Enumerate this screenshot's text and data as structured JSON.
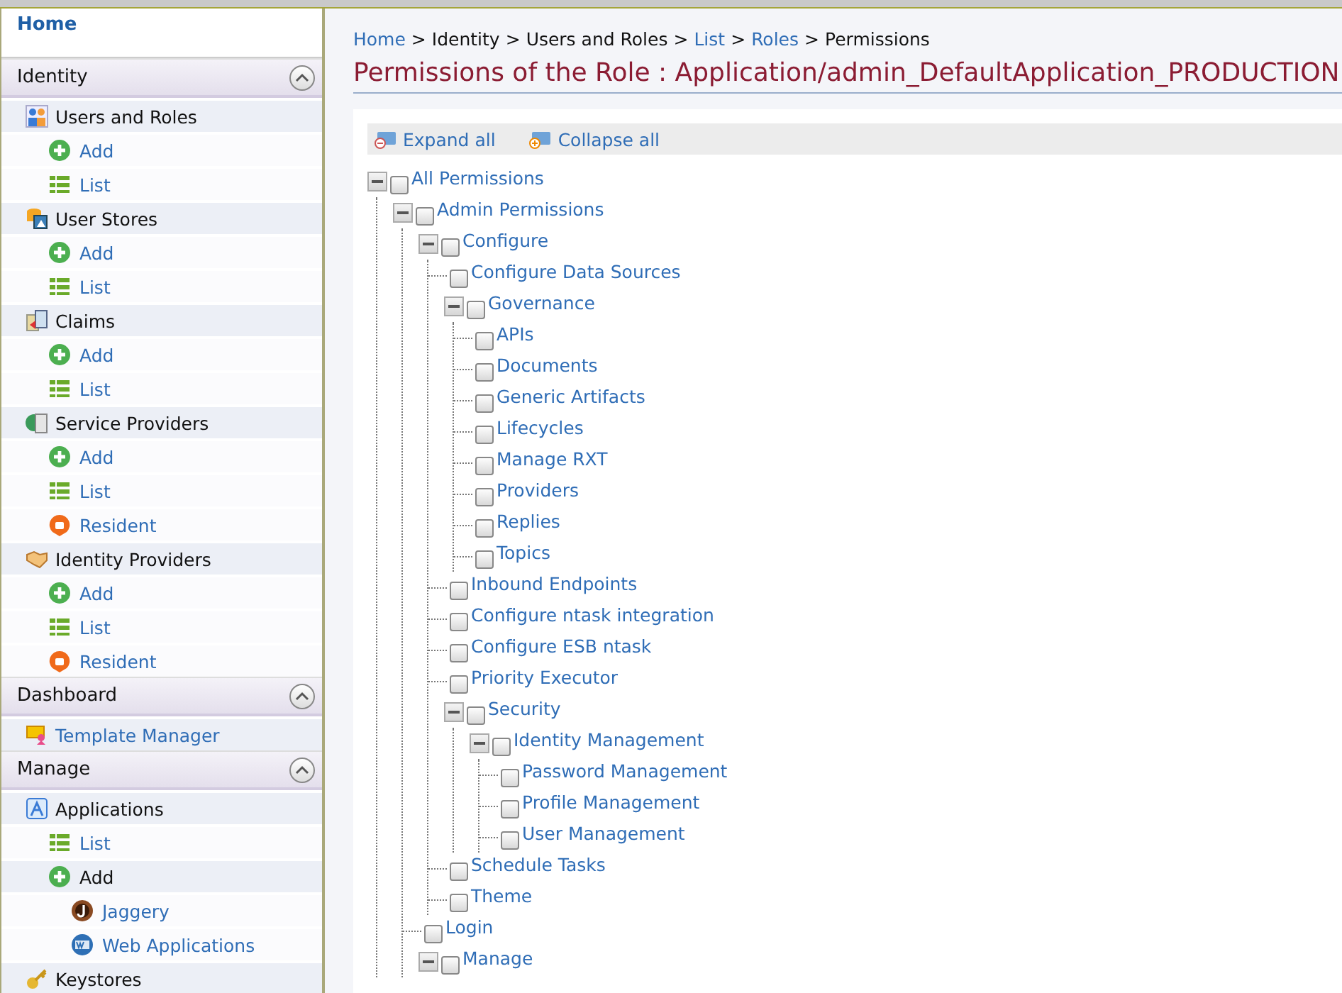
{
  "sidebar": {
    "home": "Home",
    "sections": [
      {
        "title": "Identity",
        "expanded": true,
        "items": [
          {
            "label": "Users and Roles",
            "kind": "users",
            "children": [
              {
                "label": "Add",
                "kind": "add",
                "selected": false
              },
              {
                "label": "List",
                "kind": "list",
                "selected": false
              }
            ]
          },
          {
            "label": "User Stores",
            "kind": "stores",
            "children": [
              {
                "label": "Add",
                "kind": "add",
                "selected": false
              },
              {
                "label": "List",
                "kind": "list",
                "selected": false
              }
            ]
          },
          {
            "label": "Claims",
            "kind": "claims",
            "children": [
              {
                "label": "Add",
                "kind": "add",
                "selected": false
              },
              {
                "label": "List",
                "kind": "list",
                "selected": false
              }
            ]
          },
          {
            "label": "Service Providers",
            "kind": "service",
            "children": [
              {
                "label": "Add",
                "kind": "add",
                "selected": false
              },
              {
                "label": "List",
                "kind": "list",
                "selected": false
              },
              {
                "label": "Resident",
                "kind": "resident",
                "selected": false
              }
            ]
          },
          {
            "label": "Identity Providers",
            "kind": "idp",
            "children": [
              {
                "label": "Add",
                "kind": "add",
                "selected": false
              },
              {
                "label": "List",
                "kind": "list",
                "selected": false
              },
              {
                "label": "Resident",
                "kind": "resident",
                "selected": false
              }
            ]
          }
        ]
      },
      {
        "title": "Dashboard",
        "expanded": true,
        "items": [
          {
            "label": "Template Manager",
            "kind": "template"
          }
        ]
      },
      {
        "title": "Manage",
        "expanded": true,
        "items": [
          {
            "label": "Applications",
            "kind": "apps",
            "children": [
              {
                "label": "List",
                "kind": "list",
                "selected": false
              },
              {
                "label": "Add",
                "kind": "add",
                "selected": true,
                "children": [
                  {
                    "label": "Jaggery",
                    "kind": "jaggery",
                    "selected": false
                  },
                  {
                    "label": "Web Applications",
                    "kind": "webapp",
                    "selected": false
                  }
                ]
              }
            ]
          },
          {
            "label": "Keystores",
            "kind": "keystore"
          }
        ]
      }
    ]
  },
  "breadcrumb": [
    {
      "label": "Home",
      "link": true
    },
    {
      "separator": ">",
      "label": "Identity",
      "link": false
    },
    {
      "separator": ">",
      "label": "Users and Roles",
      "link": false
    },
    {
      "separator": ">",
      "label": "List",
      "link": true
    },
    {
      "separator": ">",
      "label": "Roles",
      "link": true
    },
    {
      "separator": ">",
      "label": "Permissions",
      "link": false
    }
  ],
  "title": "Permissions of the Role : Application/admin_DefaultApplication_PRODUCTION",
  "toolbar": {
    "expand_all": "Expand all",
    "collapse_all": "Collapse all"
  },
  "tree": [
    {
      "label": "All Permissions",
      "checked": false,
      "expanded": true,
      "children": [
        {
          "label": "Admin Permissions",
          "checked": false,
          "expanded": true,
          "children": [
            {
              "label": "Configure",
              "checked": false,
              "expanded": true,
              "children": [
                {
                  "label": "Configure Data Sources",
                  "checked": false
                },
                {
                  "label": "Governance",
                  "checked": false,
                  "expanded": true,
                  "children": [
                    {
                      "label": "APIs",
                      "checked": false
                    },
                    {
                      "label": "Documents",
                      "checked": false
                    },
                    {
                      "label": "Generic Artifacts",
                      "checked": false
                    },
                    {
                      "label": "Lifecycles",
                      "checked": false
                    },
                    {
                      "label": "Manage RXT",
                      "checked": false
                    },
                    {
                      "label": "Providers",
                      "checked": false
                    },
                    {
                      "label": "Replies",
                      "checked": false
                    },
                    {
                      "label": "Topics",
                      "checked": false
                    }
                  ]
                },
                {
                  "label": "Inbound Endpoints",
                  "checked": false
                },
                {
                  "label": "Configure ntask integration",
                  "checked": false
                },
                {
                  "label": "Configure ESB ntask",
                  "checked": false
                },
                {
                  "label": "Priority Executor",
                  "checked": false
                },
                {
                  "label": "Security",
                  "checked": false,
                  "expanded": true,
                  "children": [
                    {
                      "label": "Identity Management",
                      "checked": false,
                      "expanded": true,
                      "children": [
                        {
                          "label": "Password Management",
                          "checked": false
                        },
                        {
                          "label": "Profile Management",
                          "checked": false
                        },
                        {
                          "label": "User Management",
                          "checked": false
                        }
                      ]
                    }
                  ]
                },
                {
                  "label": "Schedule Tasks",
                  "checked": false
                },
                {
                  "label": "Theme",
                  "checked": false
                }
              ]
            },
            {
              "label": "Login",
              "checked": false
            },
            {
              "label": "Manage",
              "checked": false,
              "expanded": true
            }
          ]
        }
      ]
    }
  ]
}
